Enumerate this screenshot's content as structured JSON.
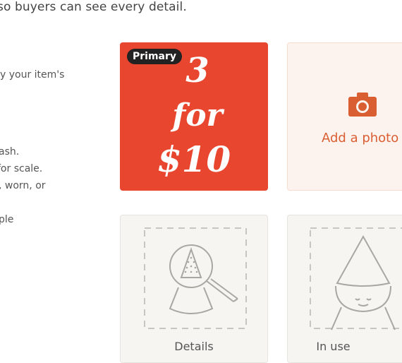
{
  "intro_text": "so buyers can see every detail.",
  "tips": [
    "y your item's",
    "ash.",
    "for scale.",
    ", worn, or",
    "ple"
  ],
  "photo_slots": {
    "primary": {
      "badge": "Primary",
      "promo_lines": [
        "3",
        "for",
        "$10"
      ]
    },
    "add_photo": {
      "label": "Add a photo"
    },
    "details": {
      "label": "Details"
    },
    "in_use": {
      "label": "In use"
    }
  },
  "colors": {
    "primary_bg": "#e8462e",
    "accent": "#d95f33",
    "add_bg": "#fdf3ee",
    "placeholder_bg": "#f6f5f1"
  },
  "icons": {
    "add_photo": "camera-icon",
    "details": "magnifier-cone-illustration",
    "in_use": "gnome-illustration"
  }
}
